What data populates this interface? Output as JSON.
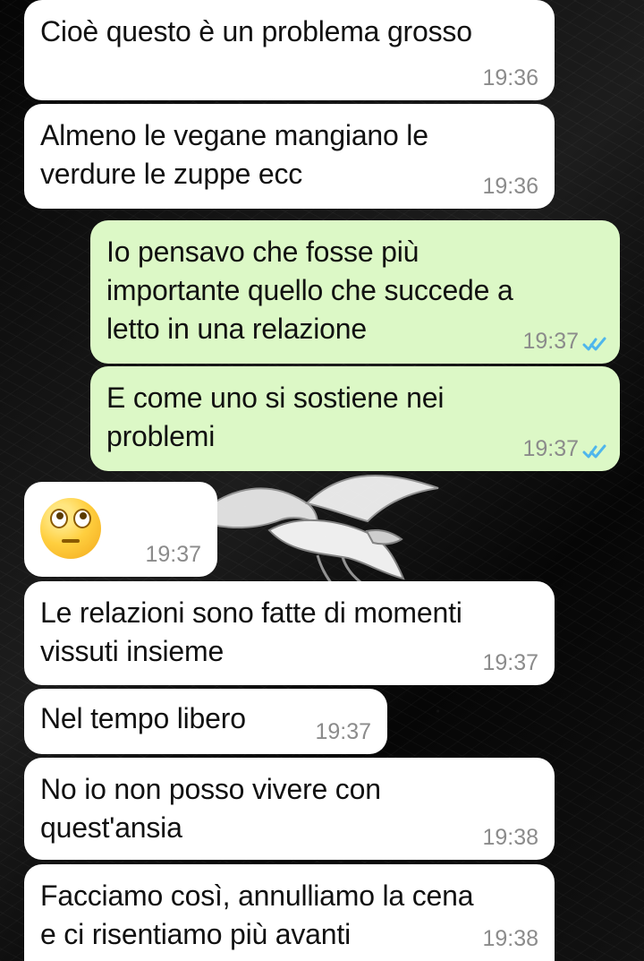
{
  "conversation": {
    "messages": [
      {
        "text": "Cioè questo è un problema grosso",
        "time": "19:36"
      },
      {
        "text": "Almeno le vegane mangiano le\nverdure le zuppe ecc",
        "time": "19:36"
      },
      {
        "text": "Io pensavo che fosse più\nimportante quello che succede a\nletto in una relazione",
        "time": "19:37"
      },
      {
        "text": "E come uno si sostiene nei\nproblemi",
        "time": "19:37"
      },
      {
        "emoji": "face-with-rolling-eyes",
        "time": "19:37"
      },
      {
        "text": "Le relazioni sono fatte di momenti\nvissuti insieme",
        "time": "19:37"
      },
      {
        "text": "Nel tempo libero",
        "time": "19:37"
      },
      {
        "text": "No io non posso vivere con\nquest'ansia",
        "time": "19:38"
      },
      {
        "text": "Facciamo così, annulliamo la cena\ne ci risentiamo più avanti",
        "time": "19:38"
      }
    ]
  },
  "colors": {
    "incoming_bubble": "#ffffff",
    "outgoing_bubble": "#dcf8c6",
    "read_receipt": "#4fb6ec",
    "timestamp": "#8b8b8b"
  },
  "icons": {
    "read_receipt": "double-check-icon",
    "emoji": "face-with-rolling-eyes-icon"
  }
}
